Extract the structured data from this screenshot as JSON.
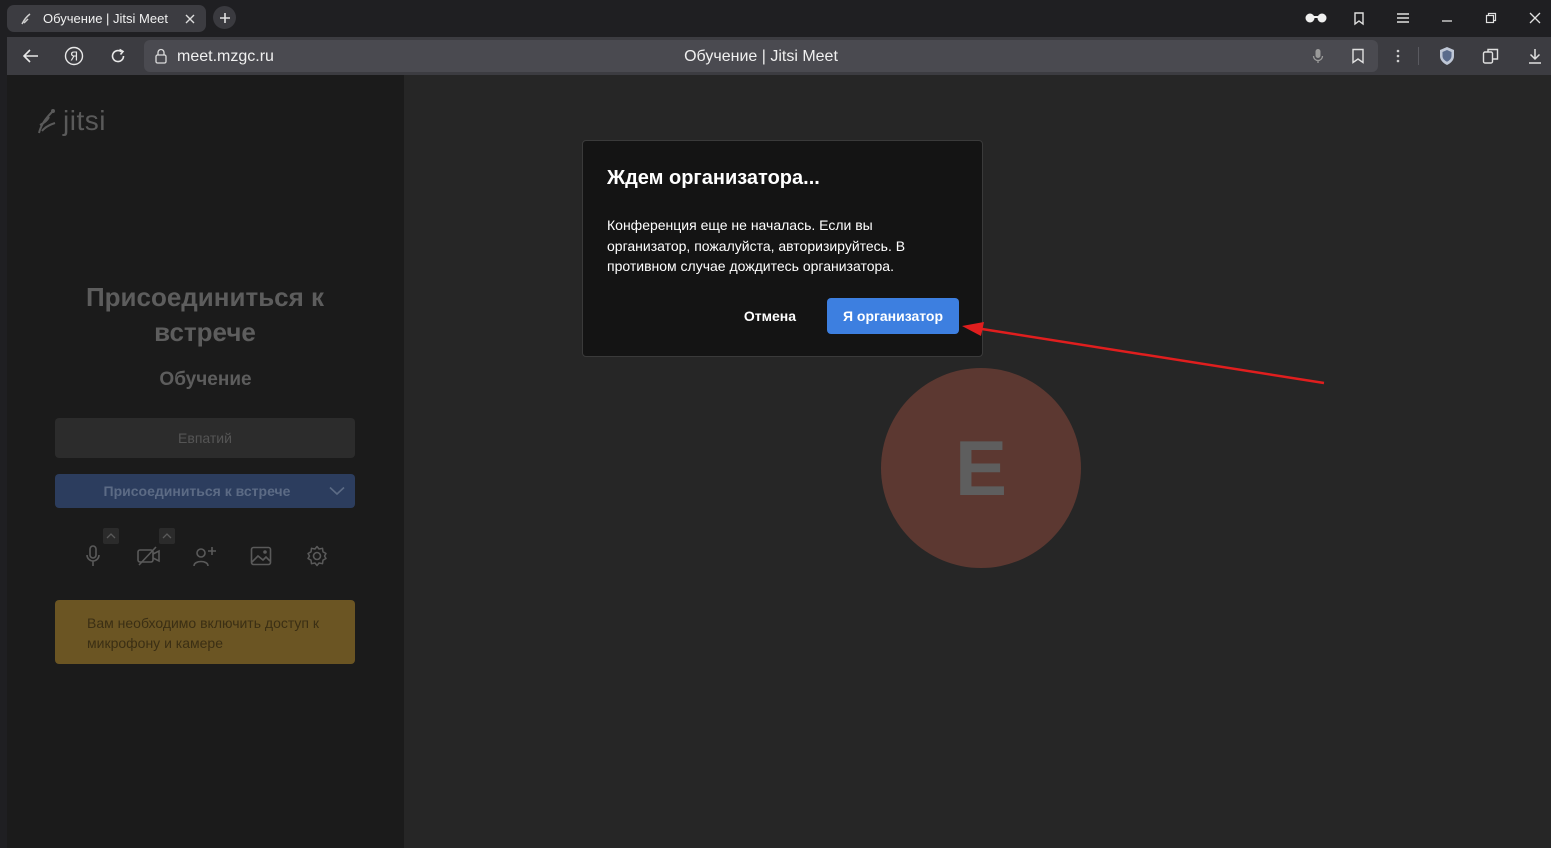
{
  "browser": {
    "tab_title": "Обучение | Jitsi Meet",
    "url": "meet.mzgc.ru",
    "page_title": "Обучение | Jitsi Meet"
  },
  "prejoin": {
    "logo_text": "jitsi",
    "title": "Присоединиться к встрече",
    "meeting_name": "Обучение",
    "name_placeholder": "Евпатий",
    "join_button": "Присоединиться к встрече",
    "warning": "Вам необходимо включить доступ к микрофону и камере",
    "icons": [
      "microphone-icon",
      "camera-off-icon",
      "invite-icon",
      "background-icon",
      "settings-icon"
    ]
  },
  "avatar": {
    "initial": "E",
    "color": "#5c3831"
  },
  "dialog": {
    "title": "Ждем организатора...",
    "body": "Конференция еще не началась. Если вы организатор, пожалуйста, авторизируйтесь. В противном случае дождитесь организатора.",
    "cancel_label": "Отмена",
    "primary_label": "Я организатор"
  },
  "colors": {
    "accent": "#3d7fe0",
    "annotation_arrow": "#e01e1e",
    "warning_bg": "#6b5523"
  }
}
